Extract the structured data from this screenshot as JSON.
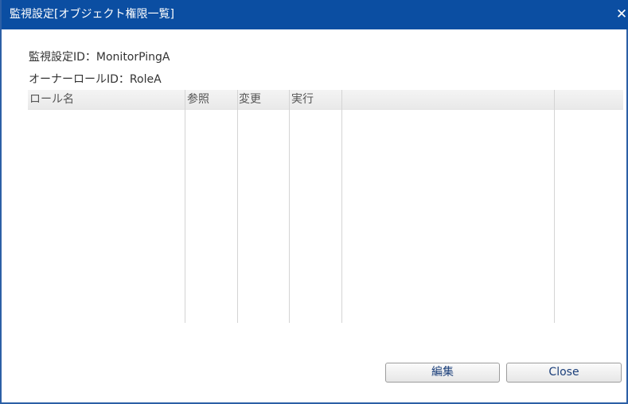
{
  "dialog": {
    "title": "監視設定[オブジェクト権限一覧]",
    "close_glyph": "✕"
  },
  "info": {
    "monitor_id_line": "監視設定ID：MonitorPingA",
    "owner_role_line": "オーナーロールID：RoleA"
  },
  "table": {
    "columns": [
      "ロール名",
      "参照",
      "変更",
      "実行",
      "",
      ""
    ],
    "rows": []
  },
  "buttons": {
    "edit_label": "編集",
    "close_label": "Close"
  }
}
